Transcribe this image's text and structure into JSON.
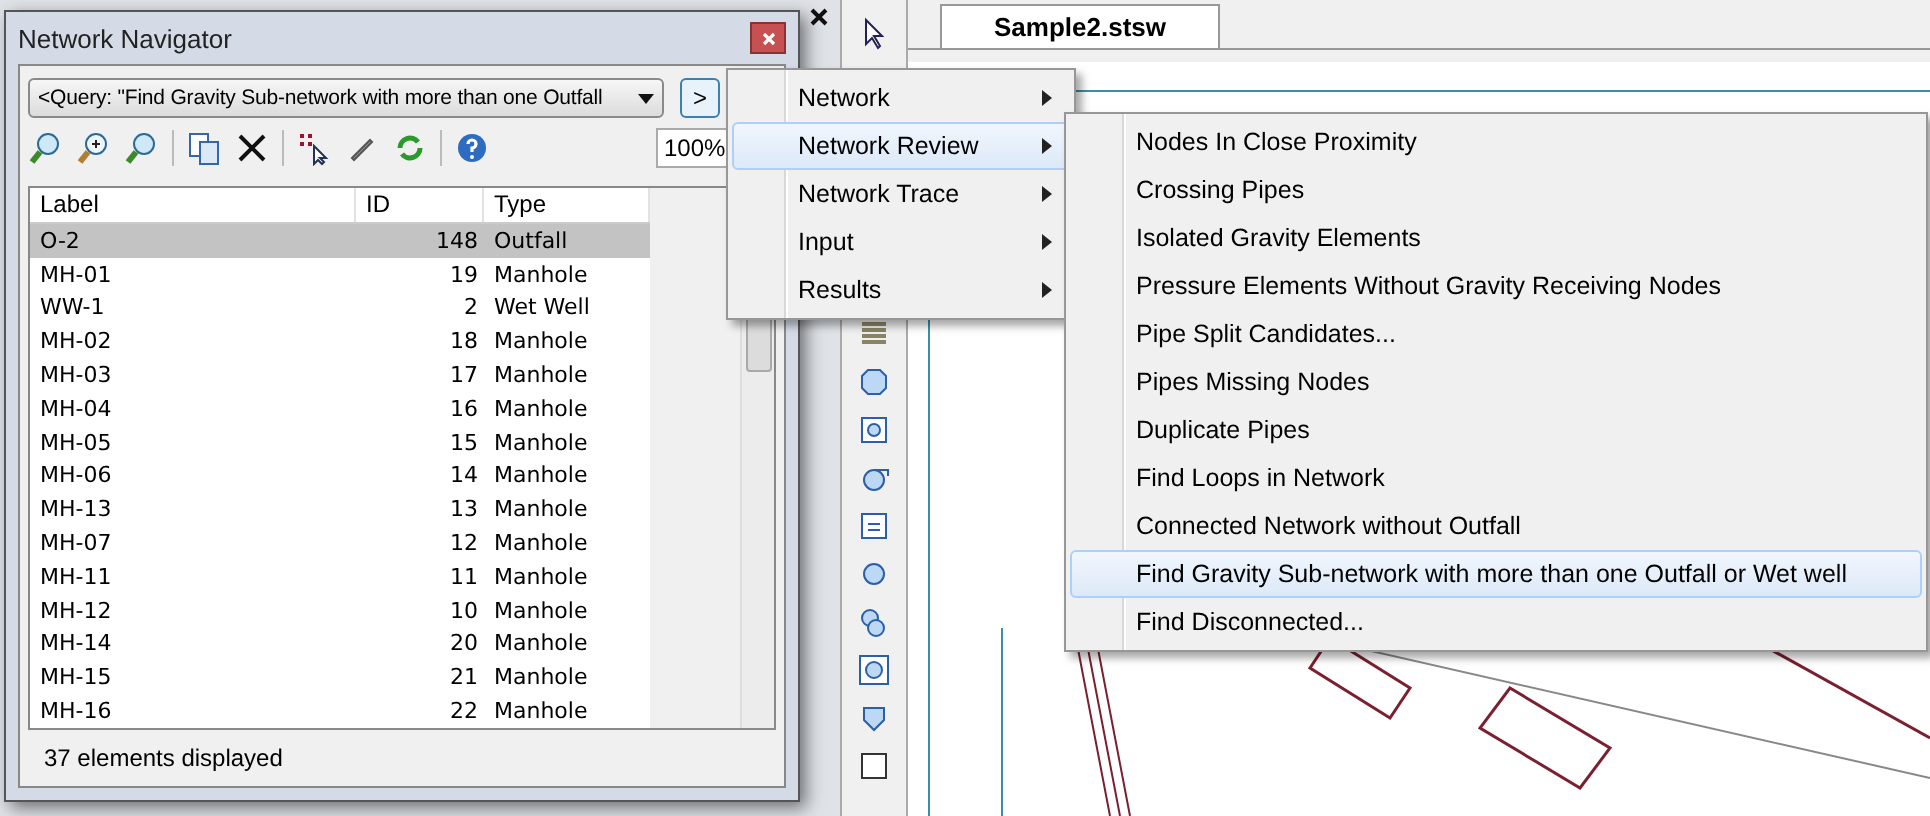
{
  "document_tab": {
    "label": "Sample2.stsw",
    "selected": true
  },
  "navigator": {
    "title": "Network Navigator",
    "query": "<Query: \"Find Gravity Sub-network with more than one Outfall",
    "zoom": "100%",
    "go_button": ">",
    "columns": [
      "Label",
      "ID",
      "Type"
    ],
    "rows": [
      {
        "label": "O-2",
        "id": "148",
        "type": "Outfall",
        "selected": true
      },
      {
        "label": "MH-01",
        "id": "19",
        "type": "Manhole",
        "selected": false
      },
      {
        "label": "WW-1",
        "id": "2",
        "type": "Wet Well",
        "selected": false
      },
      {
        "label": "MH-02",
        "id": "18",
        "type": "Manhole",
        "selected": false
      },
      {
        "label": "MH-03",
        "id": "17",
        "type": "Manhole",
        "selected": false
      },
      {
        "label": "MH-04",
        "id": "16",
        "type": "Manhole",
        "selected": false
      },
      {
        "label": "MH-05",
        "id": "15",
        "type": "Manhole",
        "selected": false
      },
      {
        "label": "MH-06",
        "id": "14",
        "type": "Manhole",
        "selected": false
      },
      {
        "label": "MH-13",
        "id": "13",
        "type": "Manhole",
        "selected": false
      },
      {
        "label": "MH-07",
        "id": "12",
        "type": "Manhole",
        "selected": false
      },
      {
        "label": "MH-11",
        "id": "11",
        "type": "Manhole",
        "selected": false
      },
      {
        "label": "MH-12",
        "id": "10",
        "type": "Manhole",
        "selected": false
      },
      {
        "label": "MH-14",
        "id": "20",
        "type": "Manhole",
        "selected": false
      },
      {
        "label": "MH-15",
        "id": "21",
        "type": "Manhole",
        "selected": false
      },
      {
        "label": "MH-16",
        "id": "22",
        "type": "Manhole",
        "selected": false
      }
    ],
    "status": "37 elements displayed"
  },
  "menu": {
    "items": [
      {
        "label": "Network",
        "selected": false
      },
      {
        "label": "Network Review",
        "selected": true
      },
      {
        "label": "Network Trace",
        "selected": false
      },
      {
        "label": "Input",
        "selected": false
      },
      {
        "label": "Results",
        "selected": false
      }
    ]
  },
  "submenu": {
    "items": [
      {
        "label": "Nodes In Close Proximity",
        "selected": false
      },
      {
        "label": "Crossing Pipes",
        "selected": false
      },
      {
        "label": "Isolated Gravity Elements",
        "selected": false
      },
      {
        "label": "Pressure Elements Without Gravity Receiving Nodes",
        "selected": false
      },
      {
        "label": "Pipe Split Candidates...",
        "selected": false
      },
      {
        "label": "Pipes Missing Nodes",
        "selected": false
      },
      {
        "label": "Duplicate Pipes",
        "selected": false
      },
      {
        "label": "Find Loops in Network",
        "selected": false
      },
      {
        "label": "Connected Network without Outfall",
        "selected": false
      },
      {
        "label": "Find Gravity Sub-network with more than one Outfall or Wet well",
        "selected": true
      },
      {
        "label": "Find Disconnected...",
        "selected": false
      }
    ]
  }
}
